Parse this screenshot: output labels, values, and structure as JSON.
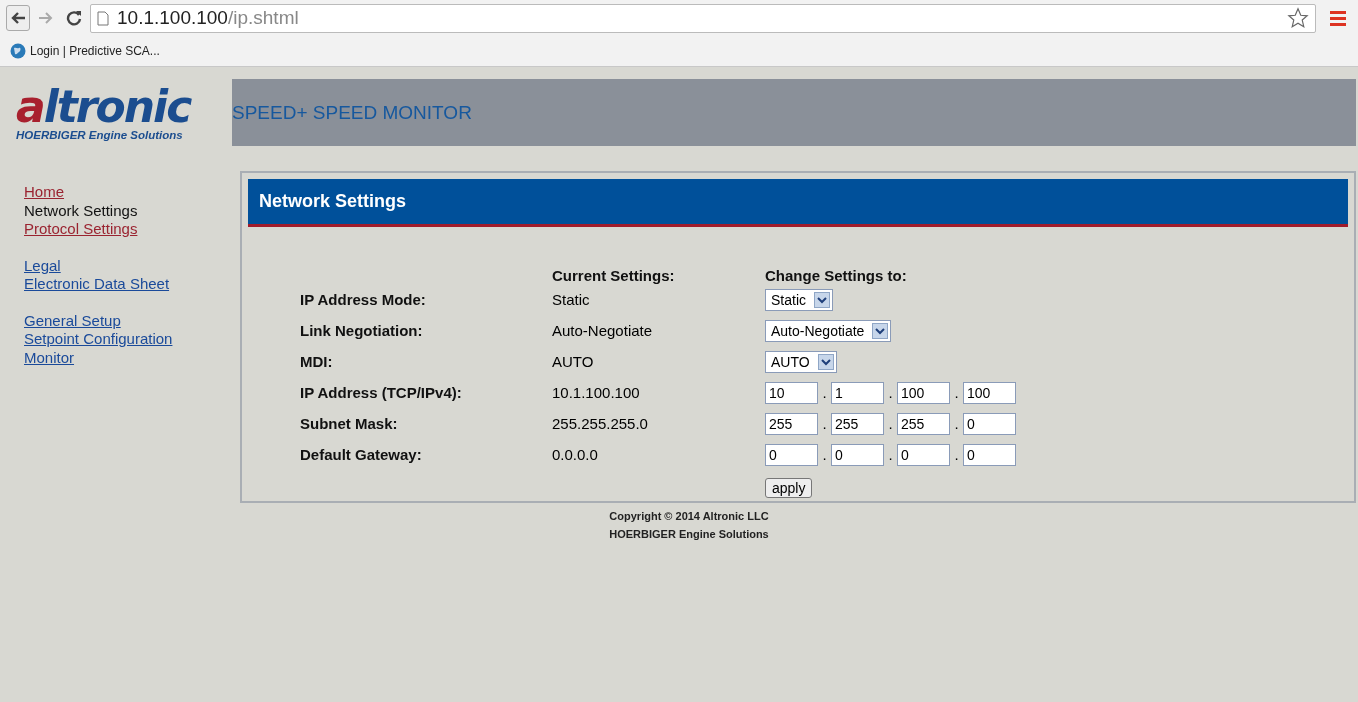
{
  "browser": {
    "url_host": "10.1.100.100",
    "url_path": "/ip.shtml",
    "bookmarks": [
      {
        "label": "Login | Predictive SCA..."
      }
    ]
  },
  "logo": {
    "text": "altronic",
    "tagline": "HOERBIGER Engine Solutions"
  },
  "header": {
    "title": "SPEED+ SPEED MONITOR"
  },
  "nav": [
    [
      {
        "label": "Home",
        "kind": "visited"
      },
      {
        "label": "Network Settings",
        "kind": "current"
      },
      {
        "label": "Protocol Settings",
        "kind": "visited"
      }
    ],
    [
      {
        "label": "Legal",
        "kind": "link"
      },
      {
        "label": "Electronic Data Sheet",
        "kind": "link"
      }
    ],
    [
      {
        "label": "General Setup",
        "kind": "link"
      },
      {
        "label": "Setpoint Configuration",
        "kind": "link"
      },
      {
        "label": "Monitor",
        "kind": "link"
      }
    ]
  ],
  "panel": {
    "title": "Network Settings",
    "current_heading": "Current Settings:",
    "change_heading": "Change Settings to:",
    "rows": [
      {
        "label": "IP Address Mode:",
        "current": "Static",
        "kind": "select",
        "value": "Static"
      },
      {
        "label": "Link Negotiation:",
        "current": "Auto-Negotiate",
        "kind": "select",
        "value": "Auto-Negotiate"
      },
      {
        "label": "MDI:",
        "current": "AUTO",
        "kind": "select",
        "value": "AUTO"
      },
      {
        "label": "IP Address (TCP/IPv4):",
        "current": "10.1.100.100",
        "kind": "octets",
        "octets": [
          "10",
          "1",
          "100",
          "100"
        ]
      },
      {
        "label": "Subnet Mask:",
        "current": "255.255.255.0",
        "kind": "octets",
        "octets": [
          "255",
          "255",
          "255",
          "0"
        ]
      },
      {
        "label": "Default Gateway:",
        "current": "0.0.0.0",
        "kind": "octets",
        "octets": [
          "0",
          "0",
          "0",
          "0"
        ]
      }
    ],
    "separator": ".",
    "button": "apply"
  },
  "footer": [
    "Copyright © 2014 Altronic LLC",
    "HOERBIGER Engine Solutions"
  ]
}
